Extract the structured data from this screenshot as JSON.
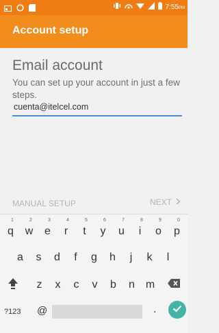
{
  "status_bar": {
    "time": "7:55",
    "ampm": "PM"
  },
  "app_bar": {
    "title": "Account setup"
  },
  "content": {
    "heading": "Email account",
    "subtext": "You can set up your account in just a few steps.",
    "email_value": "cuenta@itelcel.com"
  },
  "actions": {
    "manual_setup_label": "MANUAL SETUP",
    "next_label": "NEXT"
  },
  "keyboard": {
    "row1": [
      {
        "ch": "q",
        "hint": "1"
      },
      {
        "ch": "w",
        "hint": "2"
      },
      {
        "ch": "e",
        "hint": "3"
      },
      {
        "ch": "r",
        "hint": "4"
      },
      {
        "ch": "t",
        "hint": "5"
      },
      {
        "ch": "y",
        "hint": "6"
      },
      {
        "ch": "u",
        "hint": "7"
      },
      {
        "ch": "i",
        "hint": "8"
      },
      {
        "ch": "o",
        "hint": "9"
      },
      {
        "ch": "p",
        "hint": "0"
      }
    ],
    "row2": [
      "a",
      "s",
      "d",
      "f",
      "g",
      "h",
      "j",
      "k",
      "l"
    ],
    "row3": [
      "z",
      "x",
      "c",
      "v",
      "b",
      "n",
      "m"
    ],
    "symbols_label": "?123",
    "at_label": "@",
    "period_label": ".",
    "icons": {
      "shift": "shift-arrow-icon",
      "backspace": "backspace-icon",
      "done": "checkmark-icon"
    },
    "colors": {
      "done_bg": "#42b4a6"
    }
  },
  "colors": {
    "status_bar": "#f07d14",
    "app_bar": "#f28c1c",
    "input_underline": "#4a8fd9"
  }
}
